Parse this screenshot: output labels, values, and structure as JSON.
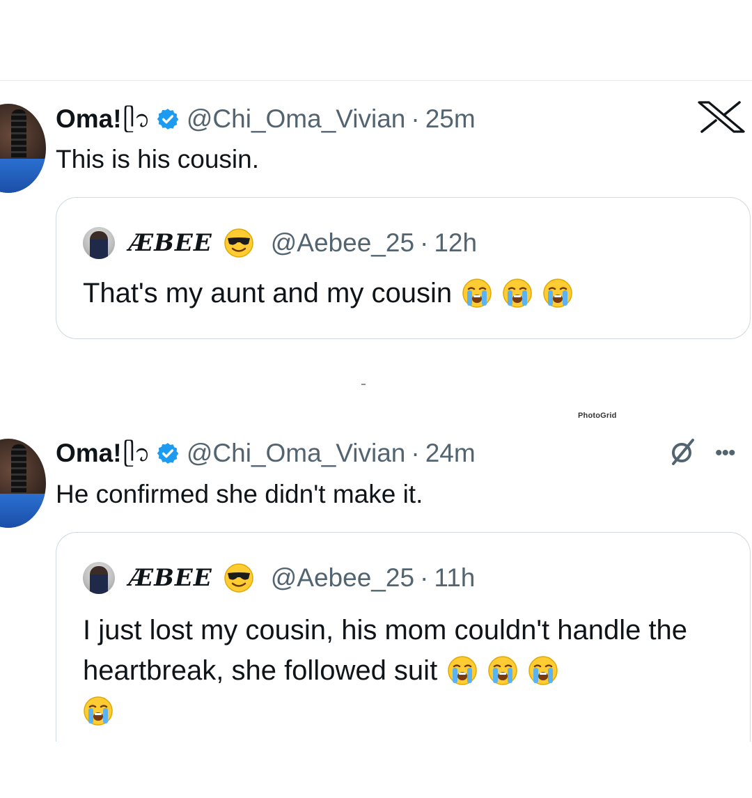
{
  "tweets": [
    {
      "name": "Oma!",
      "name_glyph": "ᥫ᭡",
      "handle": "@Chi_Oma_Vivian",
      "dot": "·",
      "time": "25m",
      "text": "This is his cousin.",
      "quote": {
        "name": "ÆBEE",
        "handle": "@Aebee_25",
        "dot": "·",
        "time": "12h",
        "text": "That's my aunt and my cousin",
        "trailing_emoji": [
          "loudly-crying-face",
          "loudly-crying-face",
          "loudly-crying-face"
        ]
      }
    },
    {
      "name": "Oma!",
      "name_glyph": "ᥫ᭡",
      "handle": "@Chi_Oma_Vivian",
      "dot": "·",
      "time": "24m",
      "text": "He confirmed she didn't make it.",
      "quote": {
        "name": "ÆBEE",
        "handle": "@Aebee_25",
        "dot": "·",
        "time": "11h",
        "text": "I just lost my cousin, his mom couldn't handle the heartbreak, she followed suit",
        "trailing_emoji": [
          "loudly-crying-face",
          "loudly-crying-face",
          "loudly-crying-face",
          "loudly-crying-face"
        ]
      }
    }
  ],
  "watermark": "PhotoGrid",
  "icons": {
    "verified": "verified-badge-icon",
    "platform": "x-logo-icon",
    "grok": "grok-icon",
    "more": "more-options-icon",
    "quote_emoji": "smiling-face-with-sunglasses"
  },
  "colors": {
    "text": "#0f1419",
    "secondary": "#536471",
    "verified": "#1d9bf0",
    "border": "#cfd9de"
  }
}
